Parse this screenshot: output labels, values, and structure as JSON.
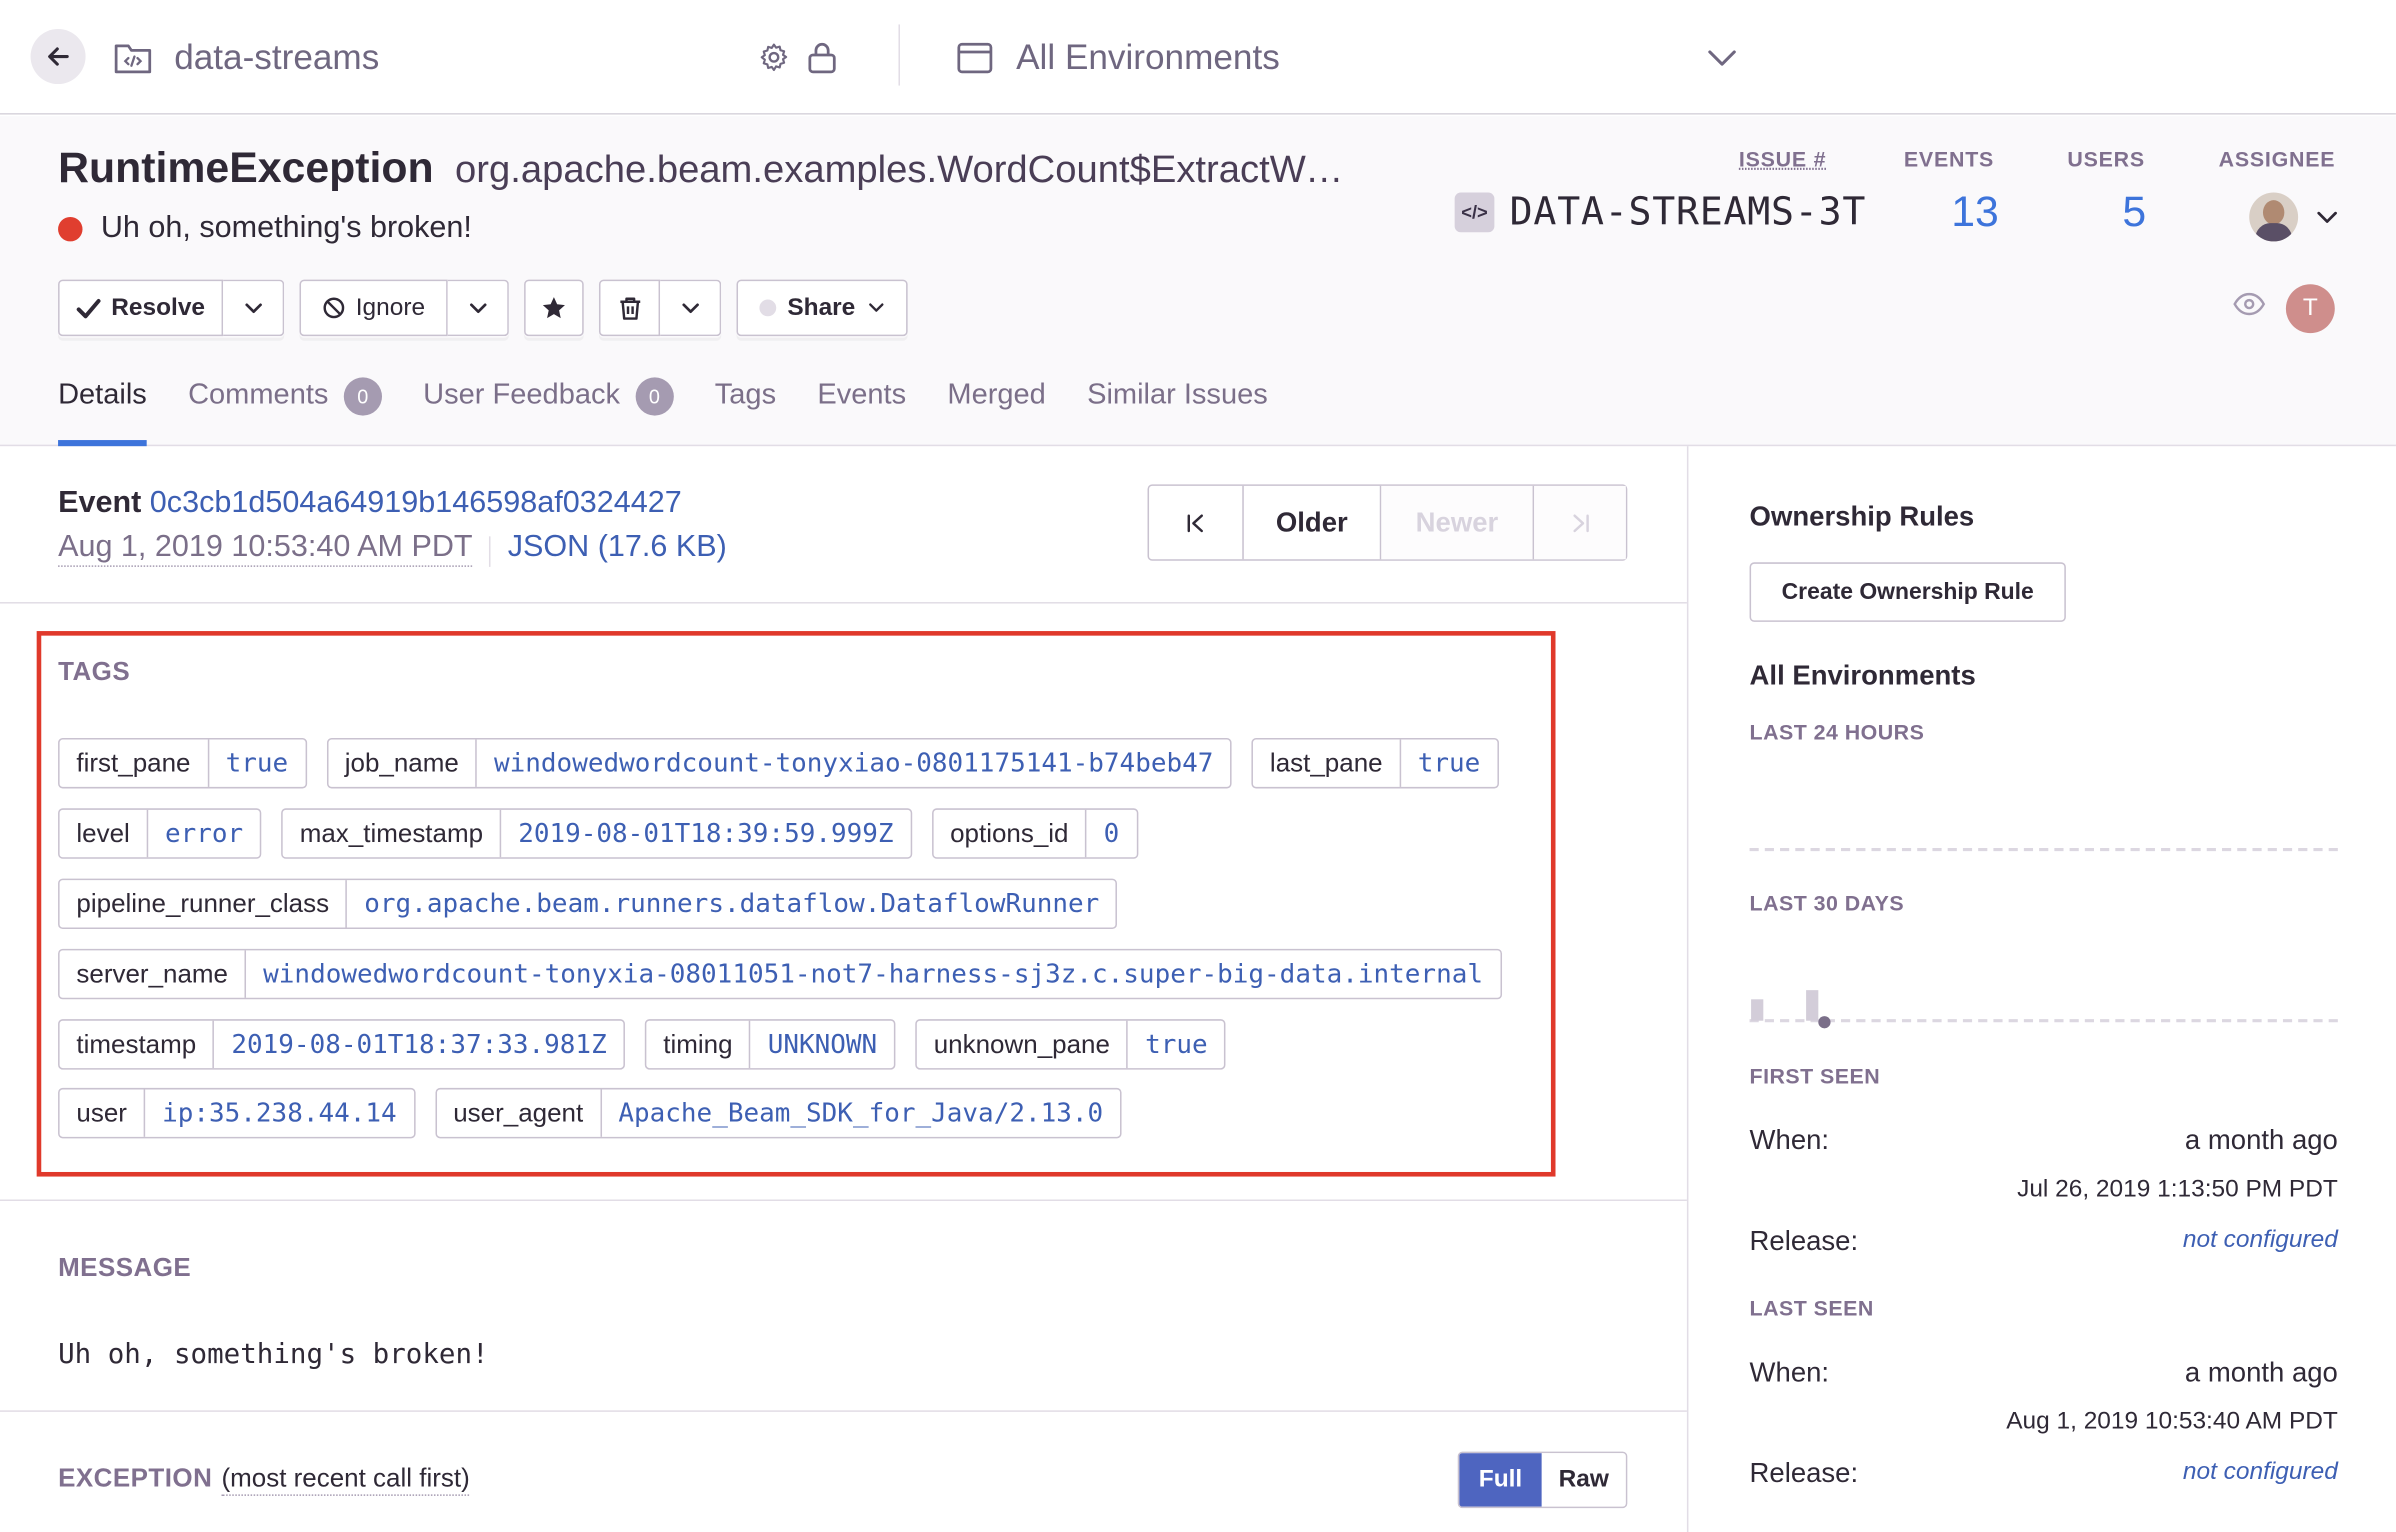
{
  "topbar": {
    "project_name": "data-streams",
    "environment": "All Environments"
  },
  "issue": {
    "type": "RuntimeException",
    "culprit": "org.apache.beam.examples.WordCount$ExtractWordsFn.processElement",
    "message": "Uh oh, something's broken!",
    "issue_label": "ISSUE #",
    "issue_id": "DATA-STREAMS-3T",
    "events_label": "EVENTS",
    "events": "13",
    "users_label": "USERS",
    "users": "5",
    "assignee_label": "ASSIGNEE",
    "viewer_initial": "T"
  },
  "actions": {
    "resolve": "Resolve",
    "ignore": "Ignore",
    "share": "Share"
  },
  "tabs": [
    {
      "label": "Details"
    },
    {
      "label": "Comments",
      "count": "0"
    },
    {
      "label": "User Feedback",
      "count": "0"
    },
    {
      "label": "Tags"
    },
    {
      "label": "Events"
    },
    {
      "label": "Merged"
    },
    {
      "label": "Similar Issues"
    }
  ],
  "event": {
    "label": "Event",
    "id": "0c3cb1d504a64919b146598af0324427",
    "date": "Aug 1, 2019 10:53:40 AM PDT",
    "json_link": "JSON (17.6 KB)",
    "older": "Older",
    "newer": "Newer"
  },
  "tags_section": {
    "title": "TAGS",
    "rows": [
      [
        {
          "k": "first_pane",
          "v": "true"
        },
        {
          "k": "job_name",
          "v": "windowedwordcount-tonyxiao-0801175141-b74beb47"
        },
        {
          "k": "last_pane",
          "v": "true"
        }
      ],
      [
        {
          "k": "level",
          "v": "error"
        },
        {
          "k": "max_timestamp",
          "v": "2019-08-01T18:39:59.999Z"
        },
        {
          "k": "options_id",
          "v": "0"
        }
      ],
      [
        {
          "k": "pipeline_runner_class",
          "v": "org.apache.beam.runners.dataflow.DataflowRunner"
        }
      ],
      [
        {
          "k": "server_name",
          "v": "windowedwordcount-tonyxia-08011051-not7-harness-sj3z.c.super-big-data.internal"
        }
      ],
      [
        {
          "k": "timestamp",
          "v": "2019-08-01T18:37:33.981Z"
        },
        {
          "k": "timing",
          "v": "UNKNOWN"
        },
        {
          "k": "unknown_pane",
          "v": "true"
        }
      ],
      [
        {
          "k": "user",
          "v": "ip:35.238.44.14"
        },
        {
          "k": "user_agent",
          "v": "Apache_Beam_SDK_for_Java/2.13.0"
        }
      ]
    ]
  },
  "message_section": {
    "title": "MESSAGE",
    "text": "Uh oh, something's broken!"
  },
  "exception_section": {
    "title": "EXCEPTION",
    "subtitle": "(most recent call first)",
    "full": "Full",
    "raw": "Raw"
  },
  "sidebar": {
    "ownership_title": "Ownership Rules",
    "create_rule": "Create Ownership Rule",
    "env_title": "All Environments",
    "last24": "LAST 24 HOURS",
    "last30": "LAST 30 DAYS",
    "first_seen_label": "FIRST SEEN",
    "last_seen_label": "LAST SEEN",
    "when_label": "When:",
    "release_label": "Release:",
    "first_seen_relative": "a month ago",
    "first_seen_date": "Jul 26, 2019 1:13:50 PM PDT",
    "first_release": "not configured",
    "last_seen_relative": "a month ago",
    "last_seen_date": "Aug 1, 2019 10:53:40 AM PDT",
    "last_release": "not configured"
  },
  "colors": {
    "accent": "#3d74db",
    "link": "#3d5fb3",
    "highlight_box": "#e0392b",
    "error_dot": "#e03e2f",
    "primary_button": "#4e65c0"
  }
}
